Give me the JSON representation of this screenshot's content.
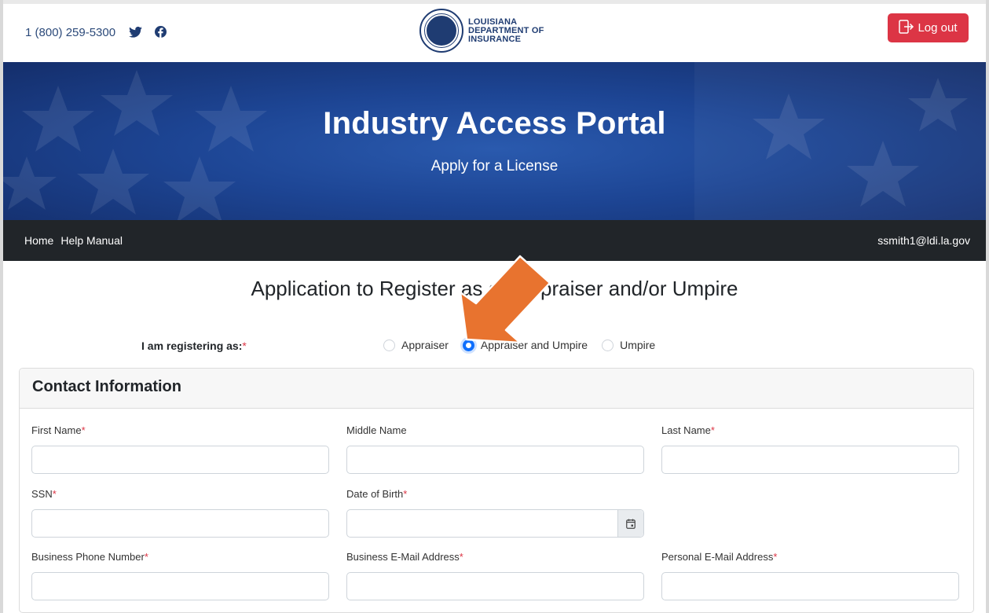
{
  "header": {
    "phone": "1 (800) 259-5300",
    "logo_lines": [
      "LOUISIANA",
      "DEPARTMENT OF",
      "INSURANCE"
    ],
    "logout_label": "Log out"
  },
  "banner": {
    "title": "Industry Access Portal",
    "subtitle": "Apply for a License"
  },
  "nav": {
    "items": [
      {
        "label": "Home"
      },
      {
        "label": "Help Manual"
      }
    ],
    "user_email": "ssmith1@ldi.la.gov"
  },
  "form": {
    "title": "Application to Register as an Appraiser and/or Umpire",
    "register_label": "I am registering as:",
    "register_options": [
      {
        "label": "Appraiser",
        "checked": false
      },
      {
        "label": "Appraiser and Umpire",
        "checked": true
      },
      {
        "label": "Umpire",
        "checked": false
      }
    ],
    "contact_section": {
      "header": "Contact Information",
      "fields": {
        "first_name": "First Name",
        "middle_name": "Middle Name",
        "last_name": "Last Name",
        "ssn": "SSN",
        "dob": "Date of Birth",
        "business_phone": "Business Phone Number",
        "business_email": "Business E-Mail Address",
        "personal_email": "Personal E-Mail Address"
      },
      "values": {
        "first_name": "",
        "middle_name": "",
        "last_name": "",
        "ssn": "",
        "dob": "",
        "business_phone": "",
        "business_email": "",
        "personal_email": ""
      }
    }
  },
  "colors": {
    "primary_navy": "#1f3c72",
    "danger": "#dc3545",
    "navbar_bg": "#212529",
    "radio_checked": "#0d6efd",
    "annotation_arrow": "#e8732f"
  },
  "icons": {
    "social": [
      "twitter-icon",
      "facebook-icon"
    ],
    "logout": "log-out-icon",
    "calendar": "calendar-icon",
    "annotation": "arrow-annotation-icon"
  }
}
